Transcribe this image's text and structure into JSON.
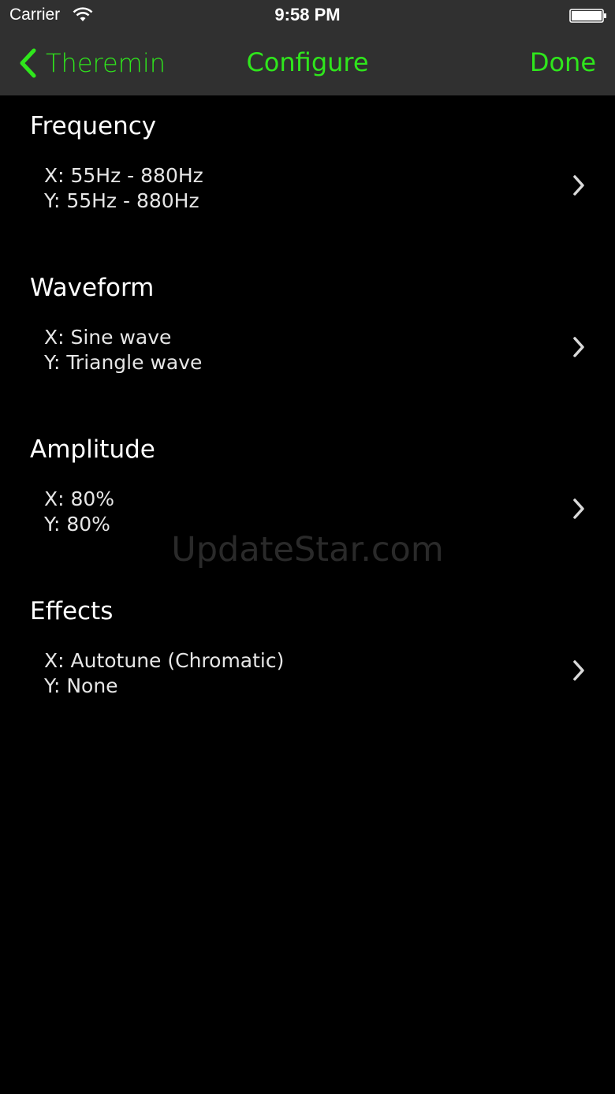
{
  "status_bar": {
    "carrier": "Carrier",
    "time": "9:58 PM",
    "wifi_icon": "wifi-icon",
    "battery_icon": "battery-icon"
  },
  "nav": {
    "back_label": "Theremin",
    "title": "Configure",
    "done_label": "Done",
    "accent_color": "#2fe61c"
  },
  "sections": [
    {
      "title": "Frequency",
      "x": "X: 55Hz - 880Hz",
      "y": "Y: 55Hz - 880Hz"
    },
    {
      "title": "Waveform",
      "x": "X: Sine wave",
      "y": "Y: Triangle wave"
    },
    {
      "title": "Amplitude",
      "x": "X: 80%",
      "y": "Y: 80%"
    },
    {
      "title": "Effects",
      "x": "X: Autotune (Chromatic)",
      "y": "Y: None"
    }
  ],
  "watermark": "UpdateStar.com",
  "colors": {
    "background": "#000000",
    "header": "#303030"
  }
}
